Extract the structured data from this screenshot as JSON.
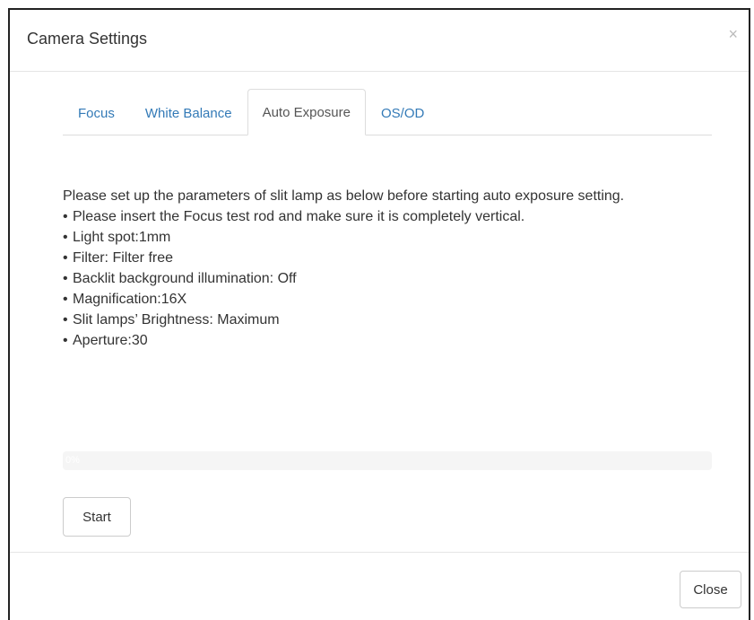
{
  "dialog": {
    "title": "Camera Settings",
    "close_icon": "×"
  },
  "tabs": [
    {
      "label": "Focus",
      "active": false
    },
    {
      "label": "White Balance",
      "active": false
    },
    {
      "label": "Auto Exposure",
      "active": true
    },
    {
      "label": "OS/OD",
      "active": false
    }
  ],
  "content": {
    "intro": "Please set up the parameters of slit lamp as below before starting auto exposure setting.",
    "items": [
      "Please insert the Focus test rod and make sure it is completely vertical.",
      "Light spot:1mm",
      "Filter: Filter free",
      "Backlit background illumination: Off",
      "Magnification:16X",
      "Slit lamps’ Brightness: Maximum",
      "Aperture:30"
    ]
  },
  "progress": {
    "value": 0,
    "label": "0%"
  },
  "buttons": {
    "start": "Start",
    "close": "Close"
  },
  "colors": {
    "link": "#337ab7",
    "text": "#333333",
    "border": "#dddddd"
  }
}
